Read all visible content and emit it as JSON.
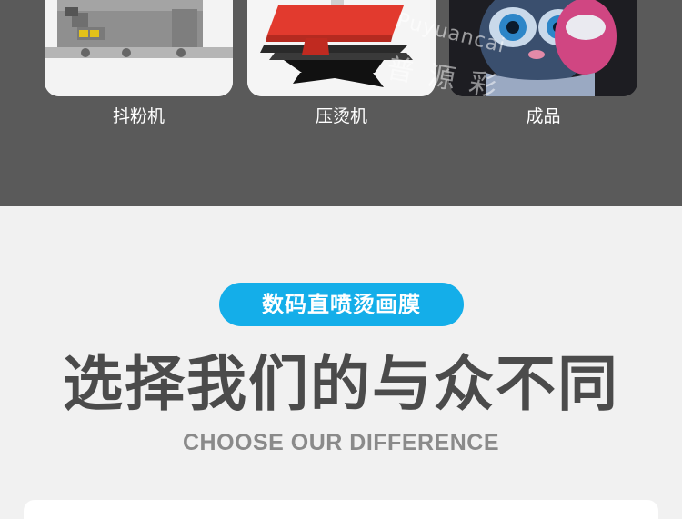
{
  "products": [
    {
      "caption": "抖粉机",
      "image": "powder-shaker-machine-photo"
    },
    {
      "caption": "压烫机",
      "image": "heat-press-machine-photo"
    },
    {
      "caption": "成品",
      "image": "printed-cat-tshirt-photo"
    }
  ],
  "watermark": {
    "latin": "Puyuancai",
    "chinese": "普源彩"
  },
  "section": {
    "badge": "数码直喷烫画膜",
    "title": "选择我们的与众不同",
    "subtitle": "CHOOSE OUR DIFFERENCE"
  },
  "colors": {
    "top_band": "#5a5a5a",
    "badge": "#14aee9",
    "title": "#4b4b4b",
    "subtitle": "#8a8a8a",
    "page_bg": "#f1f1f1"
  }
}
